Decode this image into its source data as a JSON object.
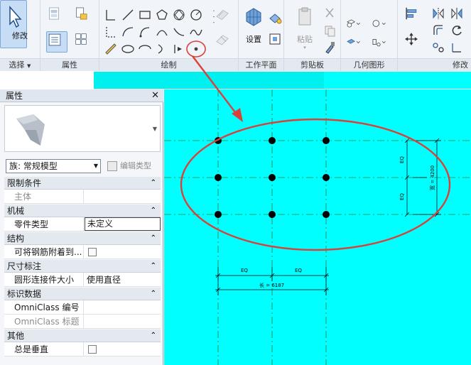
{
  "ribbon": {
    "modify_label": "修改",
    "panels": {
      "select": "选择",
      "select_arrow": "▼",
      "properties": "属性",
      "draw": "绘制",
      "workplane": "工作平面",
      "clipboard": "剪贴板",
      "geometry": "几何图形",
      "modify": "修改"
    },
    "workplane_set_label": "设置",
    "clipboard_paste_label": "粘贴"
  },
  "properties": {
    "title": "属性",
    "close": "✕",
    "family_select": "族: 常规模型",
    "edit_type_label": "编辑类型",
    "categories": [
      {
        "name": "限制条件",
        "toggle": "⌃",
        "rows": [
          {
            "key": "主体",
            "value": "",
            "dim": true
          }
        ]
      },
      {
        "name": "机械",
        "toggle": "⌃",
        "rows": [
          {
            "key": "零件类型",
            "value": "未定义",
            "boxed": true
          }
        ]
      },
      {
        "name": "结构",
        "toggle": "⌃",
        "rows": [
          {
            "key": "可将钢筋附着到...",
            "checkbox": true
          }
        ]
      },
      {
        "name": "尺寸标注",
        "toggle": "⌃",
        "rows": [
          {
            "key": "圆形连接件大小",
            "value": "使用直径"
          }
        ]
      },
      {
        "name": "标识数据",
        "toggle": "⌃",
        "rows": [
          {
            "key": "OmniClass 编号",
            "value": ""
          },
          {
            "key": "OmniClass 标题",
            "value": "",
            "dim": true
          }
        ]
      },
      {
        "name": "其他",
        "toggle": "⌃",
        "rows": [
          {
            "key": "总是垂直",
            "checkbox": true
          }
        ]
      }
    ]
  },
  "drawing": {
    "dim_eq_left": "EQ",
    "dim_eq_right": "EQ",
    "dim_length": "长 = 6187",
    "dim_eq_top": "EQ",
    "dim_eq_bottom": "EQ",
    "dim_width": "宽 = 4200",
    "colors": {
      "canvas": "#00ffff",
      "annotation": "#d9423a",
      "reference_line": "#3a7d3a",
      "point": "#000000"
    }
  },
  "icons": {
    "modify": "cursor-arrow-icon",
    "highlighted_tool": "point-element-icon"
  }
}
